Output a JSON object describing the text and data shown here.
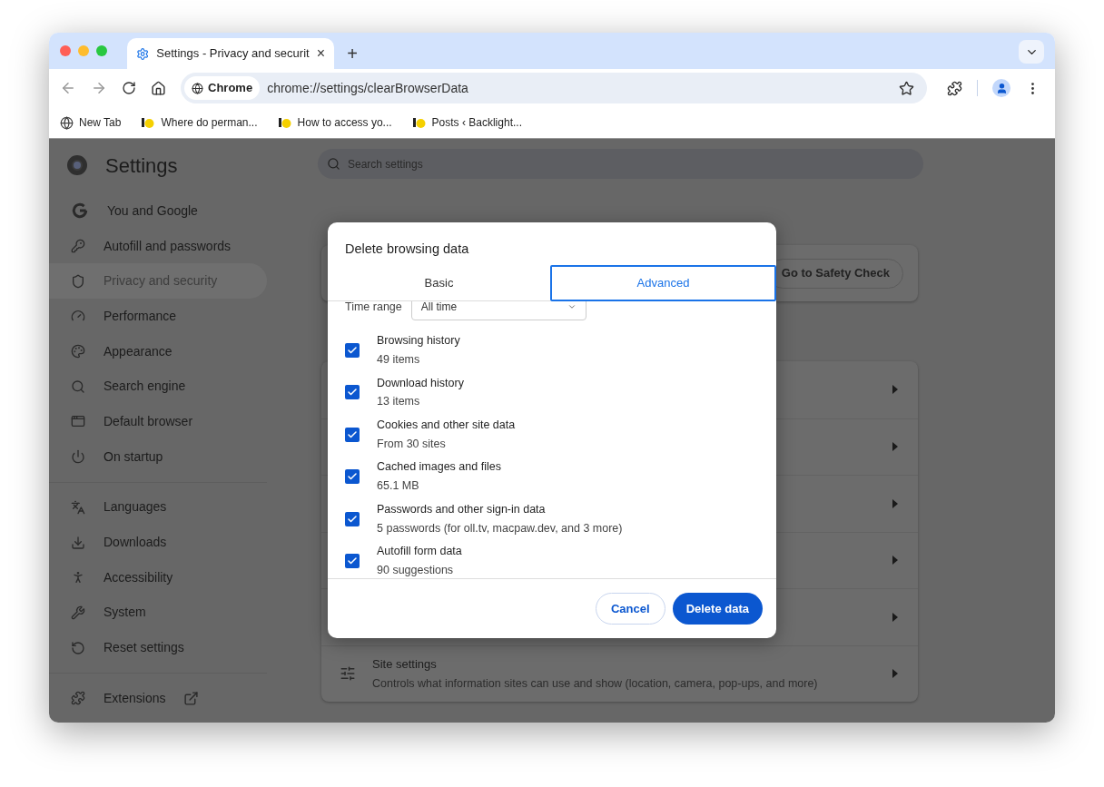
{
  "browser": {
    "tab": {
      "title": "Settings - Privacy and securit",
      "close": "×"
    },
    "new_tab": "+",
    "address": {
      "chip": "Chrome",
      "url": "chrome://settings/clearBrowserData"
    },
    "bookmarks": [
      {
        "label": "New Tab",
        "kind": "globe"
      },
      {
        "label": "Where do perman...",
        "kind": "site"
      },
      {
        "label": "How to access yo...",
        "kind": "site"
      },
      {
        "label": "Posts ‹ Backlight...",
        "kind": "site"
      }
    ]
  },
  "settings": {
    "title": "Settings",
    "search": {
      "placeholder": "Search settings"
    },
    "sidebar": [
      {
        "items": [
          {
            "label": "You and Google",
            "selected": false
          },
          {
            "label": "Autofill and passwords",
            "selected": false
          },
          {
            "label": "Privacy and security",
            "selected": true
          },
          {
            "label": "Performance",
            "selected": false
          },
          {
            "label": "Appearance",
            "selected": false
          },
          {
            "label": "Search engine",
            "selected": false
          },
          {
            "label": "Default browser",
            "selected": false
          },
          {
            "label": "On startup",
            "selected": false
          }
        ]
      },
      {
        "items": [
          {
            "label": "Languages",
            "selected": false
          },
          {
            "label": "Downloads",
            "selected": false
          },
          {
            "label": "Accessibility",
            "selected": false
          },
          {
            "label": "System",
            "selected": false
          },
          {
            "label": "Reset settings",
            "selected": false
          }
        ]
      },
      {
        "items": [
          {
            "label": "Extensions",
            "selected": false,
            "external": true
          }
        ]
      }
    ],
    "safety_check": {
      "button": "Go to Safety Check"
    },
    "privacy_rows": [
      {},
      {},
      {},
      {},
      {},
      {
        "title": "Site settings",
        "description": "Controls what information sites can use and show (location, camera, pop-ups, and more)"
      }
    ]
  },
  "dialog": {
    "title": "Delete browsing data",
    "tabs": [
      {
        "label": "Basic",
        "selected": false
      },
      {
        "label": "Advanced",
        "selected": true
      }
    ],
    "time_range": {
      "label": "Time range",
      "value": "All time"
    },
    "items": [
      {
        "title": "Browsing history",
        "detail": "49 items",
        "checked": true
      },
      {
        "title": "Download history",
        "detail": "13 items",
        "checked": true
      },
      {
        "title": "Cookies and other site data",
        "detail": "From 30 sites",
        "checked": true
      },
      {
        "title": "Cached images and files",
        "detail": "65.1 MB",
        "checked": true
      },
      {
        "title": "Passwords and other sign-in data",
        "detail": "5 passwords (for oll.tv, macpaw.dev, and 3 more)",
        "checked": true
      },
      {
        "title": "Autofill form data",
        "detail": "90 suggestions",
        "checked": true
      }
    ],
    "cancel": "Cancel",
    "confirm": "Delete data"
  }
}
